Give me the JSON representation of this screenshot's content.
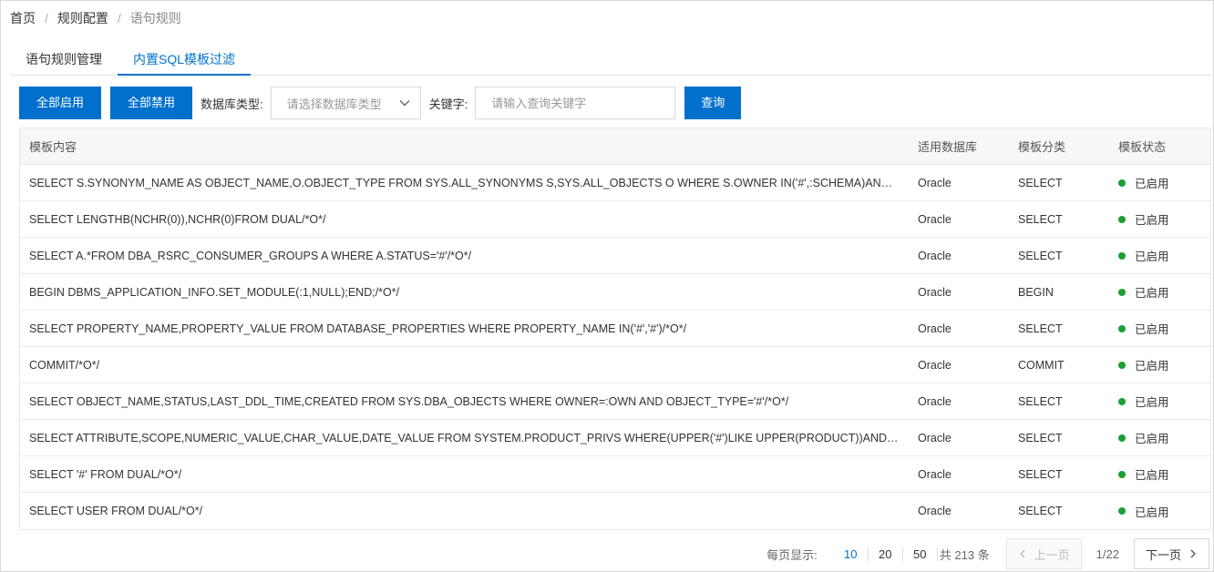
{
  "breadcrumb": {
    "items": [
      "首页",
      "规则配置",
      "语句规则"
    ],
    "separator": "/"
  },
  "tabs": [
    "语句规则管理",
    "内置SQL模板过滤"
  ],
  "toolbar": {
    "enable_all": "全部启用",
    "disable_all": "全部禁用",
    "db_type_label": "数据库类型:",
    "db_type_placeholder": "请选择数据库类型",
    "keyword_label": "关键字:",
    "keyword_placeholder": "请输入查询关键字",
    "query": "查询"
  },
  "table": {
    "headers": [
      "模板内容",
      "适用数据库",
      "模板分类",
      "模板状态"
    ],
    "rows": [
      {
        "content": "SELECT S.SYNONYM_NAME AS OBJECT_NAME,O.OBJECT_TYPE FROM SYS.ALL_SYNONYMS S,SYS.ALL_OBJECTS O WHERE S.OWNER IN('#',:SCHEMA)AND O.OWNER=S.TABLE_OWNER AND O.OBJECT_NAME=S.TABLE_NAME",
        "db": "Oracle",
        "category": "SELECT",
        "status": "已启用"
      },
      {
        "content": "SELECT LENGTHB(NCHR(0)),NCHR(0)FROM DUAL/*O*/",
        "db": "Oracle",
        "category": "SELECT",
        "status": "已启用"
      },
      {
        "content": "SELECT A.*FROM DBA_RSRC_CONSUMER_GROUPS A WHERE A.STATUS='#'/*O*/",
        "db": "Oracle",
        "category": "SELECT",
        "status": "已启用"
      },
      {
        "content": "BEGIN DBMS_APPLICATION_INFO.SET_MODULE(:1,NULL);END;/*O*/",
        "db": "Oracle",
        "category": "BEGIN",
        "status": "已启用"
      },
      {
        "content": "SELECT PROPERTY_NAME,PROPERTY_VALUE FROM DATABASE_PROPERTIES WHERE PROPERTY_NAME IN('#','#')/*O*/",
        "db": "Oracle",
        "category": "SELECT",
        "status": "已启用"
      },
      {
        "content": "COMMIT/*O*/",
        "db": "Oracle",
        "category": "COMMIT",
        "status": "已启用"
      },
      {
        "content": "SELECT OBJECT_NAME,STATUS,LAST_DDL_TIME,CREATED FROM SYS.DBA_OBJECTS WHERE OWNER=:OWN AND OBJECT_TYPE='#'/*O*/",
        "db": "Oracle",
        "category": "SELECT",
        "status": "已启用"
      },
      {
        "content": "SELECT ATTRIBUTE,SCOPE,NUMERIC_VALUE,CHAR_VALUE,DATE_VALUE FROM SYSTEM.PRODUCT_PRIVS WHERE(UPPER('#')LIKE UPPER(PRODUCT))AND(USER LIKE USERID)",
        "db": "Oracle",
        "category": "SELECT",
        "status": "已启用"
      },
      {
        "content": "SELECT '#' FROM DUAL/*O*/",
        "db": "Oracle",
        "category": "SELECT",
        "status": "已启用"
      },
      {
        "content": "SELECT USER FROM DUAL/*O*/",
        "db": "Oracle",
        "category": "SELECT",
        "status": "已启用"
      }
    ]
  },
  "pagination": {
    "per_page_label": "每页显示:",
    "sizes": [
      "10",
      "20",
      "50"
    ],
    "active_size": "10",
    "total": "共 213 条",
    "prev": "上一页",
    "page": "1/22",
    "next": "下一页"
  },
  "colors": {
    "primary": "#0070cc",
    "status_enabled": "#1aa034"
  }
}
